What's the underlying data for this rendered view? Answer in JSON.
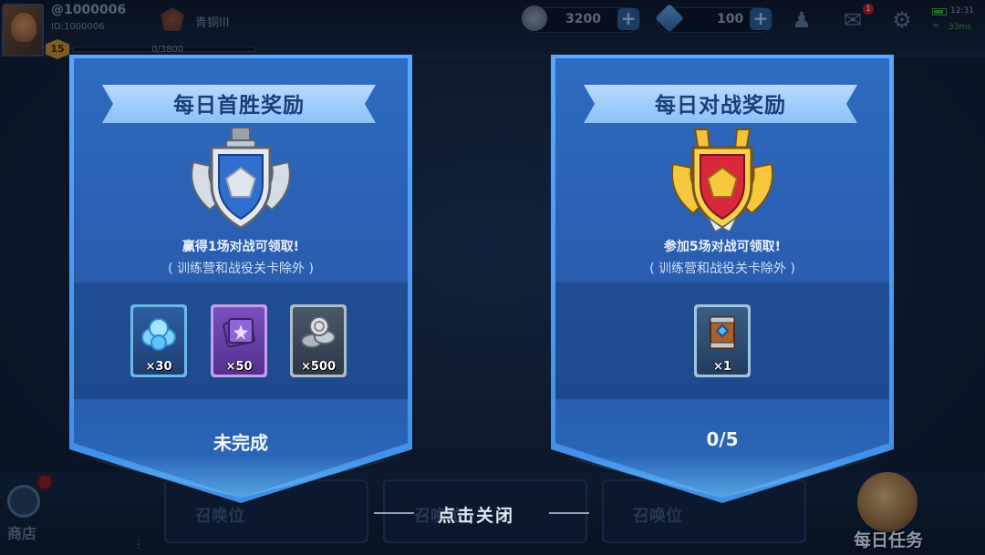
{
  "player": {
    "name": "@1000006",
    "id": "ID:1000006",
    "level": "15",
    "rank": "青铜III",
    "xp": "0/3800"
  },
  "resources": {
    "coins": "3200",
    "gems": "100"
  },
  "status": {
    "clock": "12:31",
    "ping": "33ms",
    "mail_badge": "1"
  },
  "panels": {
    "first_win": {
      "title": "每日首胜奖励",
      "desc_line1": "赢得1场对战可领取!",
      "desc_line2": "( 训练营和战役关卡除外 )",
      "rewards": [
        {
          "name": "gems",
          "qty": "×30"
        },
        {
          "name": "cards",
          "qty": "×50"
        },
        {
          "name": "coins",
          "qty": "×500"
        }
      ],
      "status": "未完成"
    },
    "daily_battle": {
      "title": "每日对战奖励",
      "desc_line1": "参加5场对战可领取!",
      "desc_line2": "( 训练营和战役关卡除外 )",
      "rewards": [
        {
          "name": "chest",
          "qty": "×1"
        }
      ],
      "status": "0/5"
    }
  },
  "bottom": {
    "shop_label": "商店",
    "slot_label": "召唤位",
    "close_hint": "点击关闭",
    "daily_task_label": "每日任务"
  },
  "colors": {
    "panel_blue": "#2a5fb2",
    "ribbon": "#a6cffb",
    "title_text": "#1a3f78"
  }
}
